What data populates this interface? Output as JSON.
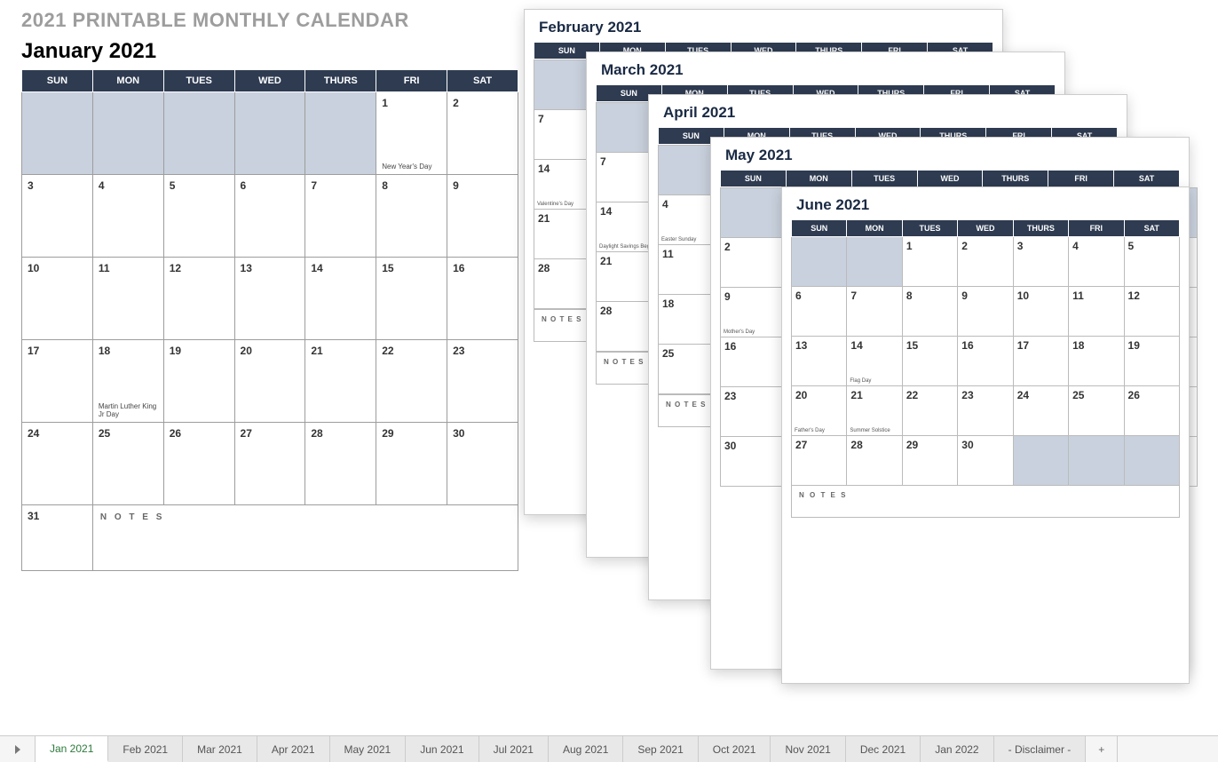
{
  "page_title": "2021 PRINTABLE MONTHLY CALENDAR",
  "days": [
    "SUN",
    "MON",
    "TUES",
    "WED",
    "THURS",
    "FRI",
    "SAT"
  ],
  "notes_label": "N O T E S",
  "jan": {
    "title": "January 2021",
    "grid": [
      [
        null,
        null,
        null,
        null,
        null,
        "1",
        "2"
      ],
      [
        "3",
        "4",
        "5",
        "6",
        "7",
        "8",
        "9"
      ],
      [
        "10",
        "11",
        "12",
        "13",
        "14",
        "15",
        "16"
      ],
      [
        "17",
        "18",
        "19",
        "20",
        "21",
        "22",
        "23"
      ],
      [
        "24",
        "25",
        "26",
        "27",
        "28",
        "29",
        "30"
      ]
    ],
    "last": "31",
    "events": {
      "1": "New Year's Day",
      "18": "Martin Luther\nKing Jr Day"
    }
  },
  "feb": {
    "title": "February 2021",
    "col0": [
      "",
      "7",
      "14",
      "21",
      "28"
    ],
    "events": {
      "14": "Valentine's Day"
    }
  },
  "mar": {
    "title": "March 2021",
    "col0": [
      "",
      "7",
      "14",
      "21",
      "28"
    ],
    "events": {
      "14": "Daylight\nSavings Begins"
    }
  },
  "apr": {
    "title": "April 2021",
    "col0": [
      "",
      "4",
      "11",
      "18",
      "25"
    ],
    "events": {
      "4": "Easter Sunday"
    }
  },
  "may": {
    "title": "May 2021",
    "col0": [
      "",
      "2",
      "9",
      "16",
      "23",
      "30"
    ],
    "events": {
      "9": "Mother's Day"
    }
  },
  "jun": {
    "title": "June 2021",
    "grid": [
      [
        null,
        null,
        "1",
        "2",
        "3",
        "4",
        "5"
      ],
      [
        "6",
        "7",
        "8",
        "9",
        "10",
        "11",
        "12"
      ],
      [
        "13",
        "14",
        "15",
        "16",
        "17",
        "18",
        "19"
      ],
      [
        "20",
        "21",
        "22",
        "23",
        "24",
        "25",
        "26"
      ],
      [
        "27",
        "28",
        "29",
        "30",
        null,
        null,
        null
      ]
    ],
    "events": {
      "14": "Flag Day",
      "20": "Father's  Day",
      "21": "Summer\nSolstice"
    }
  },
  "tabs": [
    "Jan 2021",
    "Feb 2021",
    "Mar 2021",
    "Apr 2021",
    "May 2021",
    "Jun 2021",
    "Jul 2021",
    "Aug 2021",
    "Sep 2021",
    "Oct 2021",
    "Nov 2021",
    "Dec 2021",
    "Jan 2022",
    "- Disclaimer -"
  ],
  "active_tab": 0
}
